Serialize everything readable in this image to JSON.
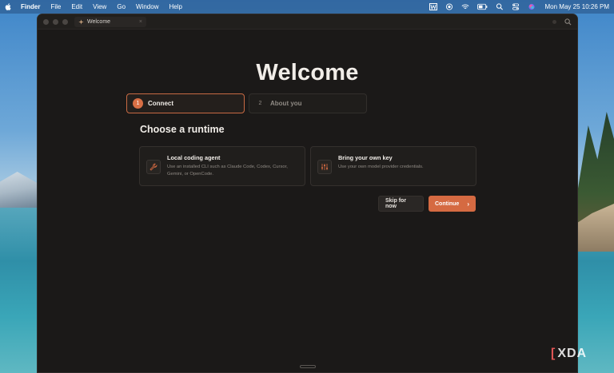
{
  "menubar": {
    "app_name": "Finder",
    "items": [
      "File",
      "Edit",
      "View",
      "Go",
      "Window",
      "Help"
    ],
    "clock": "Mon May 25  10:26 PM"
  },
  "window": {
    "tab_label": "Welcome"
  },
  "main": {
    "title": "Welcome",
    "steps": [
      {
        "number": "1",
        "label": "Connect"
      },
      {
        "number": "2",
        "label": "About you"
      }
    ],
    "section_title": "Choose a runtime",
    "cards": [
      {
        "title": "Local coding agent",
        "description": "Use an installed CLI such as Claude Code, Codex, Cursor, Gemini, or OpenCode.",
        "icon": "wrench-icon"
      },
      {
        "title": "Bring your own key",
        "description": "Use your own model provider credentials.",
        "icon": "sliders-icon"
      }
    ],
    "skip_label": "Skip for now",
    "continue_label": "Continue"
  },
  "watermark": {
    "text": "XDA"
  },
  "colors": {
    "accent": "#d56a42",
    "window_bg": "#1b1918"
  }
}
